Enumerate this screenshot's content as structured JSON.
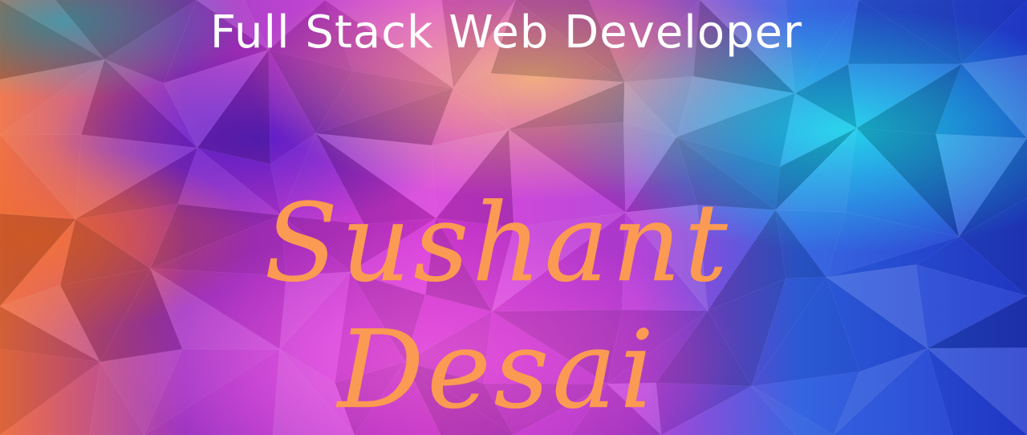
{
  "banner": {
    "headline": "Full Stack Web Developer",
    "name_first": "Sushant",
    "name_last": "Desai"
  },
  "colors": {
    "headline_text": "#ffffff",
    "name_text": "#fb9a52",
    "bg_orange": "#ef6a3a",
    "bg_purple": "#6a2bd8",
    "bg_magenta": "#e23ce0",
    "bg_peach": "#f0a878",
    "bg_cyan": "#1ec6e6",
    "bg_blue": "#2a45d6"
  }
}
